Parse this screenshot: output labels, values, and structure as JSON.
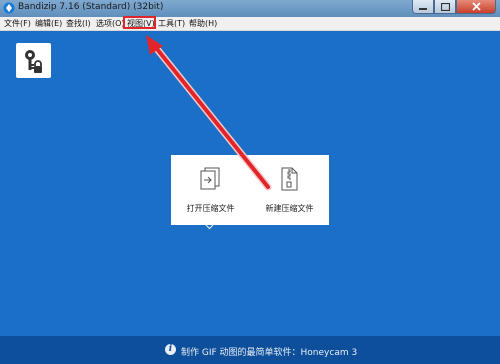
{
  "window": {
    "title": "Bandizip 7.16 (Standard) (32bit)"
  },
  "menu": {
    "items": [
      {
        "label": "文件(F)"
      },
      {
        "label": "编辑(E)"
      },
      {
        "label": "查找(I)"
      },
      {
        "label": "选项(O)"
      },
      {
        "label": "视图(V)",
        "highlighted": true
      },
      {
        "label": "工具(T)"
      },
      {
        "label": "帮助(H)"
      }
    ]
  },
  "main": {
    "tiles": [
      {
        "label": "打开压缩文件",
        "icon": "open-archive-icon"
      },
      {
        "label": "新建压缩文件",
        "icon": "new-archive-icon"
      }
    ]
  },
  "footer": {
    "text": "制作 GIF 动图的最简单软件：Honeycam 3"
  },
  "colors": {
    "background": "#1c6fc6",
    "footer": "#0d4f9a",
    "annotation": "#e0262b"
  }
}
